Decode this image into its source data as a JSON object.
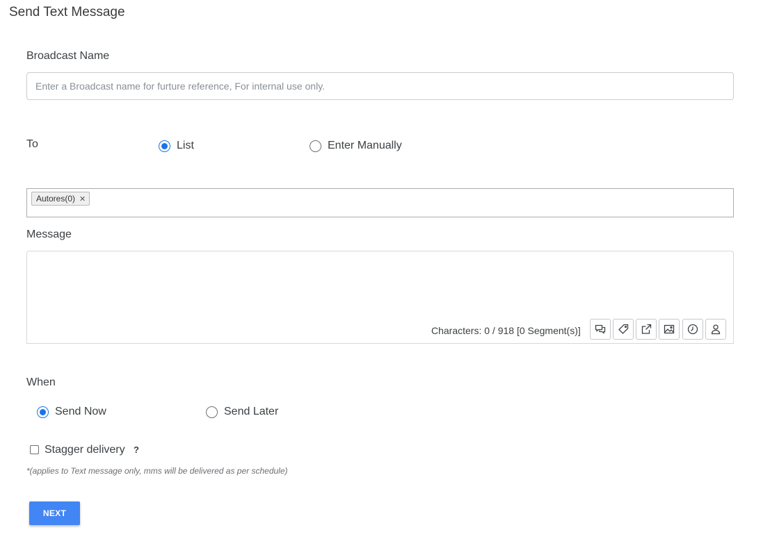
{
  "page_title": "Send Text Message",
  "broadcast": {
    "label": "Broadcast Name",
    "value": "",
    "placeholder": "Enter a Broadcast name for furture reference, For internal use only."
  },
  "recipients": {
    "label": "To",
    "options": [
      {
        "label": "List",
        "checked": true
      },
      {
        "label": "Enter Manually",
        "checked": false
      }
    ],
    "tags": [
      {
        "label": "Autores(0)",
        "remove_glyph": "✕"
      }
    ]
  },
  "message": {
    "label": "Message",
    "value": "",
    "char_count_text": "Characters: 0 / 918 [0 Segment(s)]",
    "tools": [
      {
        "name": "templates-icon"
      },
      {
        "name": "tag-icon"
      },
      {
        "name": "external-link-icon"
      },
      {
        "name": "image-icon"
      },
      {
        "name": "clock-icon"
      },
      {
        "name": "user-icon"
      }
    ]
  },
  "schedule": {
    "label": "When",
    "options": [
      {
        "label": "Send Now",
        "checked": true
      },
      {
        "label": "Send Later",
        "checked": false
      }
    ]
  },
  "stagger": {
    "label": "Stagger delivery",
    "checked": false,
    "help_glyph": "?",
    "note": "*(applies to Text message only, mms will be delivered as per schedule)"
  },
  "next_button": {
    "label": "NEXT"
  },
  "colors": {
    "accent": "#1a73e8",
    "button": "#4285f4"
  }
}
